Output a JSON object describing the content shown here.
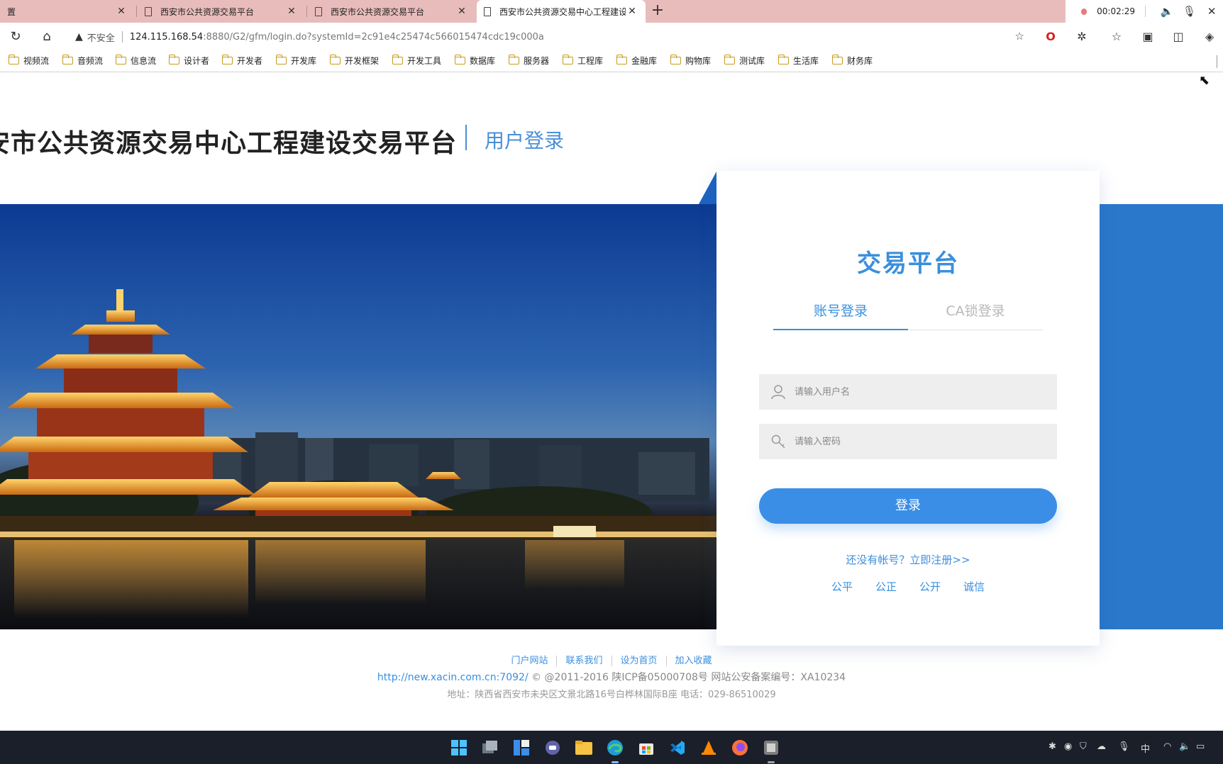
{
  "tabs": [
    {
      "title": "置"
    },
    {
      "title": "西安市公共资源交易平台"
    },
    {
      "title": "西安市公共资源交易平台"
    },
    {
      "title": "西安市公共资源交易中心工程建设"
    }
  ],
  "recorder": {
    "time": "00:02:29"
  },
  "address": {
    "security": "不安全",
    "host": "124.115.168.54",
    "path": ":8880/G2/gfm/login.do?systemId=2c91e4c25474c566015474cdc19c000a"
  },
  "bookmarks": [
    "视频流",
    "音频流",
    "信息流",
    "设计者",
    "开发者",
    "开发库",
    "开发框架",
    "开发工具",
    "数据库",
    "服务器",
    "工程库",
    "金融库",
    "购物库",
    "测试库",
    "生活库",
    "财务库"
  ],
  "header": {
    "site_title": "安市公共资源交易中心工程建设交易平台",
    "subtitle": "用户登录"
  },
  "login": {
    "title": "交易平台",
    "tab_account": "账号登录",
    "tab_ca": "CA锁登录",
    "username_placeholder": "请输入用户名",
    "password_placeholder": "请输入密码",
    "submit": "登录",
    "register": "还没有帐号？立即注册>>",
    "values": [
      "公平",
      "公正",
      "公开",
      "诚信"
    ]
  },
  "footer": {
    "links": [
      "门户网站",
      "联系我们",
      "设为首页",
      "加入收藏"
    ],
    "url": "http://new.xacin.com.cn:7092/",
    "copyright": "© @2011-2016 陕ICP备05000708号 网站公安备案编号：XA10234",
    "address": "地址：陕西省西安市未央区文景北路16号白桦林国际B座 电话：029-86510029"
  },
  "tray": {
    "ime": "中"
  },
  "colors": {
    "accent": "#3a8fdd",
    "button": "#3a8ee6",
    "tabbar": "#e9bcbc",
    "taskbar": "#1a1f29"
  }
}
